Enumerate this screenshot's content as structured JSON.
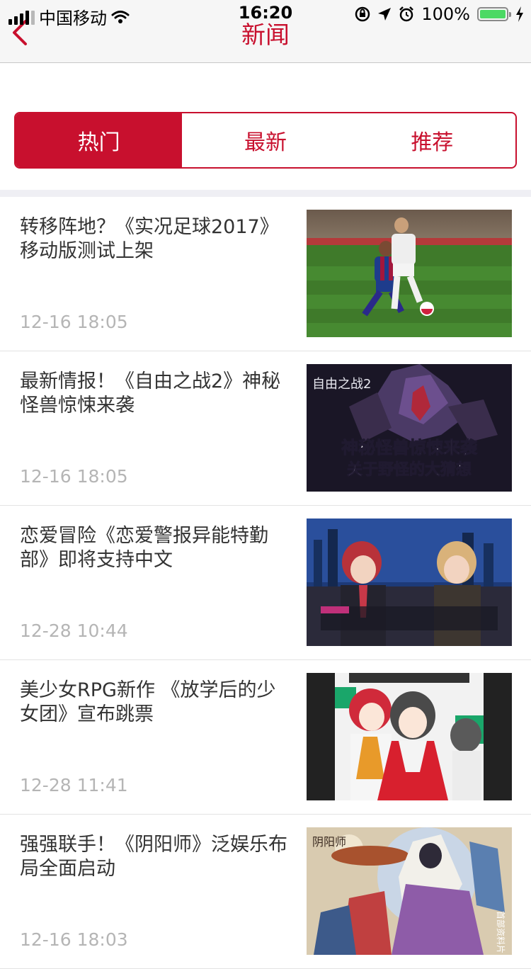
{
  "status_bar": {
    "carrier": "中国移动",
    "time": "16:20",
    "battery": "100%"
  },
  "nav": {
    "title": "新闻"
  },
  "tabs": [
    {
      "label": "热门",
      "active": true
    },
    {
      "label": "最新",
      "active": false
    },
    {
      "label": "推荐",
      "active": false
    }
  ],
  "accent_color": "#c8102e",
  "news": [
    {
      "title": "转移阵地？《实况足球2017》移动版测试上架",
      "time": "12-16 18:05",
      "image": "soccer-game-image"
    },
    {
      "title": "最新情报！《自由之战2》神秘怪兽惊悚来袭",
      "time": "12-16 18:05",
      "image": "monster-game-image",
      "image_text": {
        "logo": "自由之战2",
        "line1": "神秘怪兽惊悚来袭",
        "line2": "关于野怪的大猜想"
      }
    },
    {
      "title": "恋爱冒险《恋爱警报异能特勤部》即将支持中文",
      "time": "12-28 10:44",
      "image": "romance-game-image"
    },
    {
      "title": "美少女RPG新作 《放学后的少女团》宣布跳票",
      "time": "12-28 11:41",
      "image": "anime-girls-image"
    },
    {
      "title": "强强联手！《阴阳师》泛娱乐布局全面启动",
      "time": "12-16 18:03",
      "image": "onmyoji-image",
      "image_text": {
        "logo": "阴阳师",
        "side": "首部资料片"
      }
    }
  ]
}
